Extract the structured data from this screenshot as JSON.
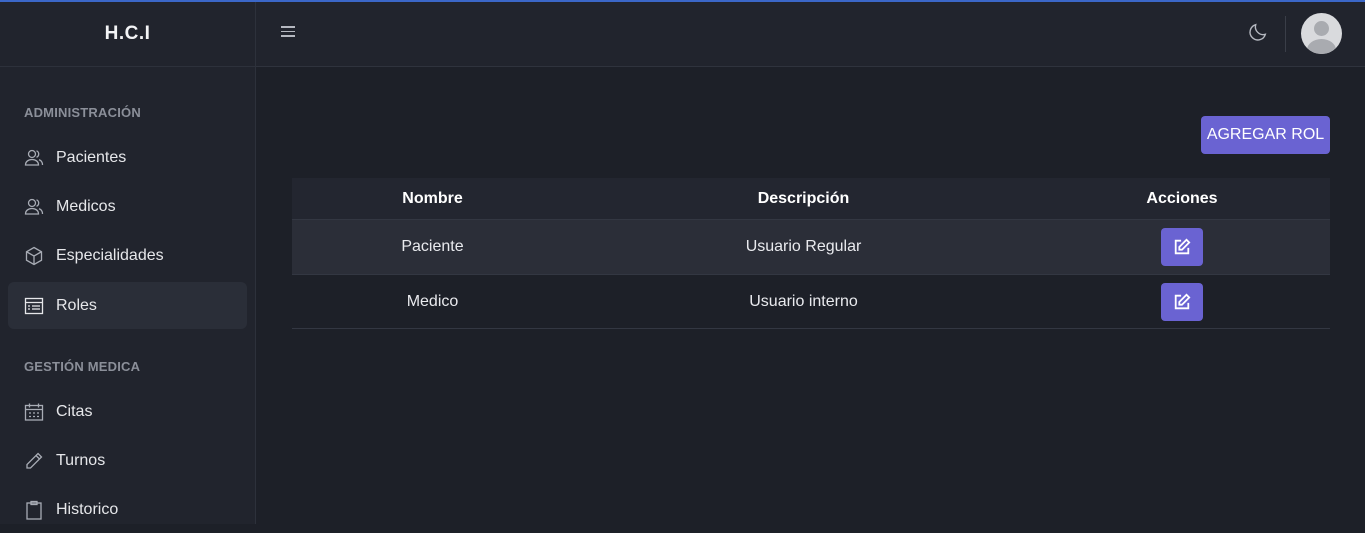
{
  "app": {
    "brand": "H.C.I"
  },
  "sidebar": {
    "sections": [
      {
        "title": "ADMINISTRACIÓN"
      },
      {
        "title": "GESTIÓN MEDICA"
      }
    ],
    "items": [
      {
        "label": "Pacientes",
        "icon": "users-icon"
      },
      {
        "label": "Medicos",
        "icon": "users-icon"
      },
      {
        "label": "Especialidades",
        "icon": "hexagon-icon"
      },
      {
        "label": "Roles",
        "icon": "table-list-icon",
        "active": true
      },
      {
        "label": "Citas",
        "icon": "calendar-icon"
      },
      {
        "label": "Turnos",
        "icon": "pencil-icon"
      },
      {
        "label": "Historico",
        "icon": "clipboard-icon"
      }
    ]
  },
  "header": {
    "menu_icon": "hamburger-icon",
    "theme_icon": "moon-icon",
    "avatar_icon": "user-avatar-icon"
  },
  "main": {
    "add_button": "AGREGAR ROL",
    "table": {
      "headers": [
        "Nombre",
        "Descripción",
        "Acciones"
      ],
      "rows": [
        {
          "nombre": "Paciente",
          "descripcion": "Usuario Regular"
        },
        {
          "nombre": "Medico",
          "descripcion": "Usuario interno"
        }
      ]
    }
  },
  "colors": {
    "accent": "#6a63d2",
    "background": "#1d2028",
    "panel": "#21242d",
    "topline": "#3b67c8"
  }
}
